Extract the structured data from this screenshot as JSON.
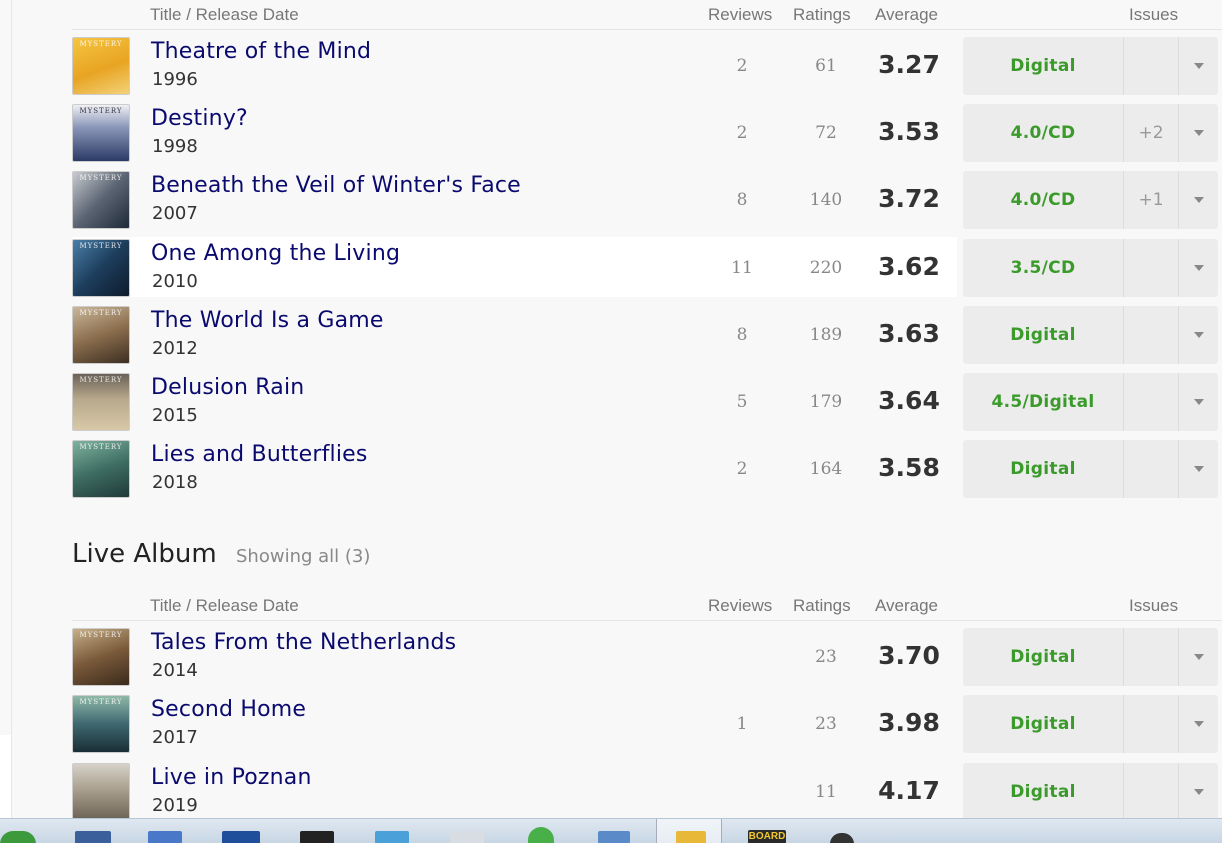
{
  "columns": {
    "title": "Title / Release Date",
    "reviews": "Reviews",
    "ratings": "Ratings",
    "average": "Average",
    "issues": "Issues"
  },
  "albums": [
    {
      "title": "Theatre of the Mind",
      "year": "1996",
      "reviews": "2",
      "ratings": "61",
      "average": "3.27",
      "issue": "Digital",
      "more": "",
      "cover_text": "MYSTERY"
    },
    {
      "title": "Destiny?",
      "year": "1998",
      "reviews": "2",
      "ratings": "72",
      "average": "3.53",
      "issue": "4.0/CD",
      "more": "+2",
      "cover_text": "MYSTERY"
    },
    {
      "title": "Beneath the Veil of Winter's Face",
      "year": "2007",
      "reviews": "8",
      "ratings": "140",
      "average": "3.72",
      "issue": "4.0/CD",
      "more": "+1",
      "cover_text": "MYSTERY"
    },
    {
      "title": "One Among the Living",
      "year": "2010",
      "reviews": "11",
      "ratings": "220",
      "average": "3.62",
      "issue": "3.5/CD",
      "more": "",
      "cover_text": "MYSTERY"
    },
    {
      "title": "The World Is a Game",
      "year": "2012",
      "reviews": "8",
      "ratings": "189",
      "average": "3.63",
      "issue": "Digital",
      "more": "",
      "cover_text": "MYSTERY"
    },
    {
      "title": "Delusion Rain",
      "year": "2015",
      "reviews": "5",
      "ratings": "179",
      "average": "3.64",
      "issue": "4.5/Digital",
      "more": "",
      "cover_text": "MYSTERY"
    },
    {
      "title": "Lies and Butterflies",
      "year": "2018",
      "reviews": "2",
      "ratings": "164",
      "average": "3.58",
      "issue": "Digital",
      "more": "",
      "cover_text": "MYSTERY"
    }
  ],
  "live_section": {
    "title": "Live Album",
    "count": "Showing all (3)"
  },
  "live_albums": [
    {
      "title": "Tales From the Netherlands",
      "year": "2014",
      "reviews": "",
      "ratings": "23",
      "average": "3.70",
      "issue": "Digital",
      "more": "",
      "cover_text": "MYSTERY"
    },
    {
      "title": "Second Home",
      "year": "2017",
      "reviews": "1",
      "ratings": "23",
      "average": "3.98",
      "issue": "Digital",
      "more": "",
      "cover_text": "MYSTERY"
    },
    {
      "title": "Live in Poznan",
      "year": "2019",
      "reviews": "",
      "ratings": "11",
      "average": "4.17",
      "issue": "Digital",
      "more": "",
      "cover_text": ""
    }
  ],
  "colors": {
    "title_link": "#0a0a6e",
    "issue_green": "#3a9a2a",
    "issue_bg": "#ececec"
  },
  "taskbar": {
    "board_label": "BOARD"
  }
}
